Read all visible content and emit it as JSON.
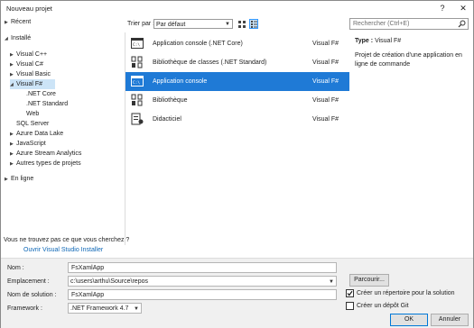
{
  "window": {
    "title": "Nouveau projet",
    "help_label": "?",
    "close_label": "✕"
  },
  "tree": {
    "items": [
      {
        "label": "Récent",
        "expandable": true
      },
      {
        "label": "Installé",
        "expandable": true,
        "expanded": true
      },
      {
        "label": "Visual C++",
        "expandable": true
      },
      {
        "label": "Visual C#",
        "expandable": true
      },
      {
        "label": "Visual Basic",
        "expandable": true
      },
      {
        "label": "Visual F#",
        "expandable": true,
        "expanded": true,
        "selected": true
      },
      {
        "label": ".NET Core",
        "expandable": false
      },
      {
        "label": ".NET Standard",
        "expandable": false
      },
      {
        "label": "Web",
        "expandable": false
      },
      {
        "label": "SQL Server",
        "expandable": false
      },
      {
        "label": "Azure Data Lake",
        "expandable": true
      },
      {
        "label": "JavaScript",
        "expandable": true
      },
      {
        "label": "Azure Stream Analytics",
        "expandable": true
      },
      {
        "label": "Autres types de projets",
        "expandable": true
      },
      {
        "label": "En ligne",
        "expandable": true
      }
    ]
  },
  "toolbar": {
    "sort_label": "Trier par :",
    "sort_value": "Par défaut"
  },
  "templates": [
    {
      "name": "Application console (.NET Core)",
      "lang": "Visual F#",
      "icon": "console-core-icon"
    },
    {
      "name": "Bibliothèque de classes (.NET Standard)",
      "lang": "Visual F#",
      "icon": "class-library-standard-icon"
    },
    {
      "name": "Application console",
      "lang": "Visual F#",
      "icon": "console-icon",
      "selected": true
    },
    {
      "name": "Bibliothèque",
      "lang": "Visual F#",
      "icon": "library-icon"
    },
    {
      "name": "Didacticiel",
      "lang": "Visual F#",
      "icon": "tutorial-icon"
    }
  ],
  "search": {
    "placeholder": "Rechercher (Ctrl+E)"
  },
  "description": {
    "type_label": "Type :",
    "type_value": "Visual F#",
    "text": "Projet de création d'une application en ligne de commande"
  },
  "help": {
    "question": "Vous ne trouvez pas ce que vous cherchez ?",
    "link": "Ouvrir Visual Studio Installer"
  },
  "form": {
    "name_label": "Nom :",
    "name_value": "FsXamlApp",
    "location_label": "Emplacement :",
    "location_value": "c:\\users\\arthu\\Source\\repos",
    "browse_label": "Parcourir...",
    "solution_label": "Nom de solution :",
    "solution_value": "FsXamlApp",
    "framework_label": "Framework :",
    "framework_value": ".NET Framework 4.7",
    "create_dir_label": "Créer un répertoire pour la solution",
    "create_dir_checked": true,
    "create_git_label": "Créer un dépôt Git",
    "create_git_checked": false,
    "ok_label": "OK",
    "cancel_label": "Annuler"
  },
  "colors": {
    "selection": "#1f7ad6",
    "tree_selection": "#cce4f7",
    "link": "#0e67b6"
  }
}
